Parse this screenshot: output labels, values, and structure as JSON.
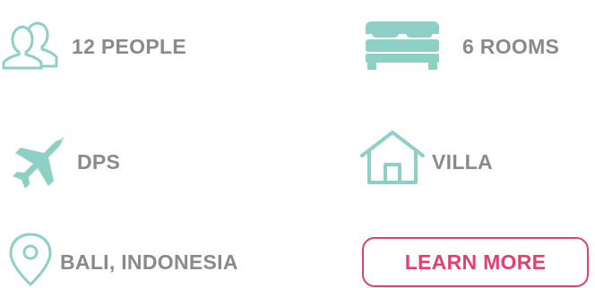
{
  "colors": {
    "icon_teal": "#8ed0c6",
    "text_gray": "#8a8a8a",
    "accent_pink": "#e3406f"
  },
  "features": [
    {
      "icon": "people-icon",
      "label": "12 PEOPLE"
    },
    {
      "icon": "bed-icon",
      "label": "6 ROOMS"
    },
    {
      "icon": "airplane-icon",
      "label": "DPS"
    },
    {
      "icon": "house-icon",
      "label": "VILLA"
    },
    {
      "icon": "location-pin-icon",
      "label": "BALI, INDONESIA"
    }
  ],
  "cta": {
    "label": "LEARN MORE"
  }
}
